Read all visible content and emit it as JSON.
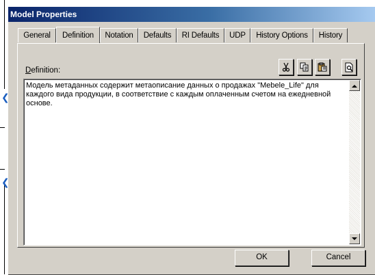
{
  "window": {
    "title": "Model Properties"
  },
  "tabs": [
    {
      "label": "General",
      "active": false
    },
    {
      "label": "Definition",
      "active": true
    },
    {
      "label": "Notation",
      "active": false
    },
    {
      "label": "Defaults",
      "active": false
    },
    {
      "label": "RI Defaults",
      "active": false
    },
    {
      "label": "UDP",
      "active": false
    },
    {
      "label": "History Options",
      "active": false
    },
    {
      "label": "History",
      "active": false
    }
  ],
  "definition": {
    "label_accel": "D",
    "label_rest": "efinition:",
    "text": "Модель метаданных содержит метаописание данных о продажах \"Mebele_Life\" для каждого вида продукции, в соответствие с каждым оплаченным счетом на ежедневной основе."
  },
  "toolbar": {
    "icons": [
      "cut-icon",
      "copy-icon",
      "paste-icon",
      "preview-icon"
    ]
  },
  "buttons": {
    "ok": "OK",
    "cancel": "Cancel"
  }
}
